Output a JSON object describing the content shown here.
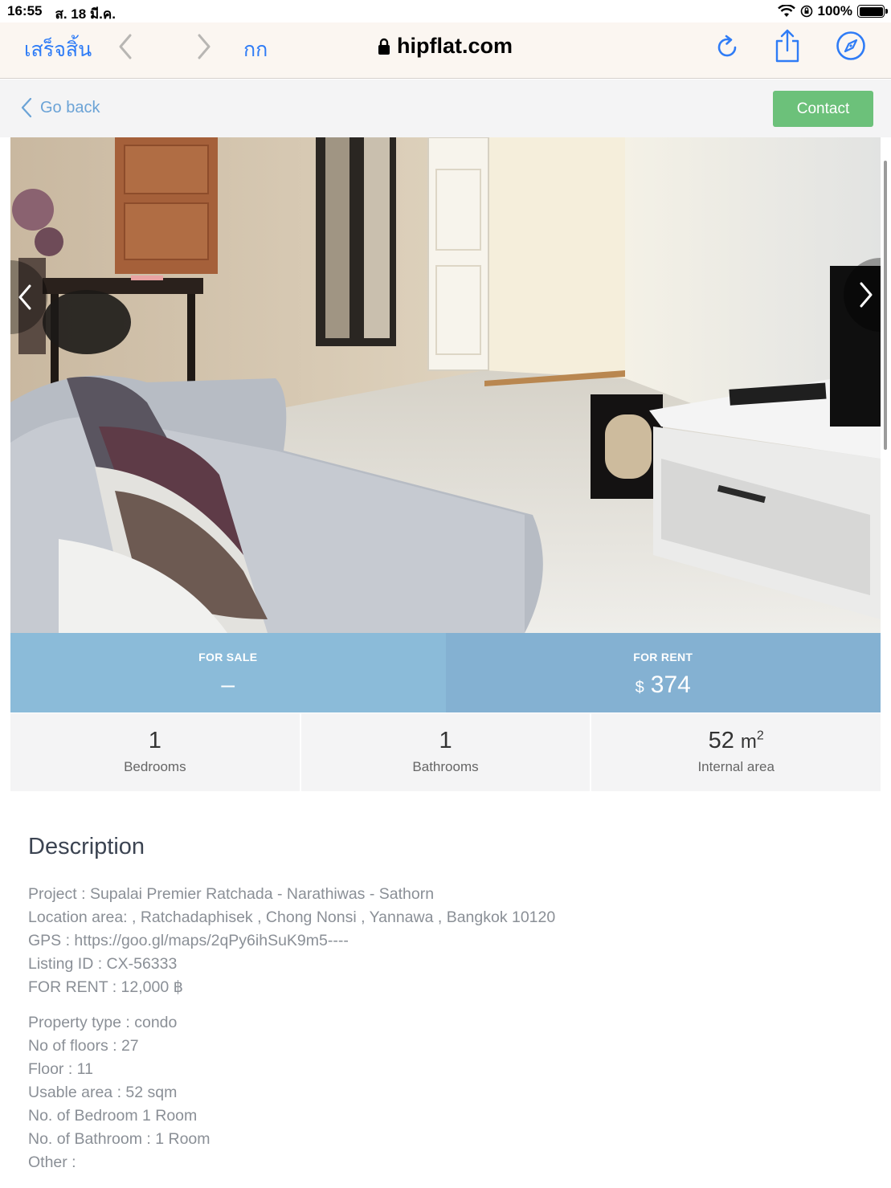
{
  "status_bar": {
    "time": "16:55",
    "date": "ส. 18 มี.ค.",
    "battery": "100%"
  },
  "browser": {
    "done_label": "เสร็จสิ้น",
    "text_size_label": "กก",
    "url": "hipflat.com"
  },
  "header": {
    "go_back_label": "Go back",
    "contact_label": "Contact"
  },
  "price": {
    "sale_label": "FOR SALE",
    "sale_value": "–",
    "rent_label": "FOR RENT",
    "rent_currency": "$",
    "rent_value": "374"
  },
  "stats": [
    {
      "value": "1",
      "label": "Bedrooms"
    },
    {
      "value": "1",
      "label": "Bathrooms"
    },
    {
      "value": "52",
      "unit": "m",
      "sup": "2",
      "label": "Internal area"
    }
  ],
  "description": {
    "title": "Description",
    "block1": [
      "Project : Supalai Premier Ratchada - Narathiwas - Sathorn",
      "Location area: , Ratchadaphisek , Chong Nonsi , Yannawa , Bangkok 10120",
      "GPS : https://goo.gl/maps/2qPy6ihSuK9m5----",
      "Listing ID : CX-56333",
      "FOR RENT : 12,000 ฿"
    ],
    "block2": [
      "Property type : condo",
      "No of floors : 27",
      "Floor : 11",
      "Usable area : 52 sqm",
      "No. of Bedroom 1 Room",
      "No. of Bathroom : 1 Room",
      "Other :"
    ]
  },
  "colors": {
    "link_blue": "#2f7cf6",
    "contact_green": "#6cc17a",
    "price_blue": "#8bbbd9"
  }
}
